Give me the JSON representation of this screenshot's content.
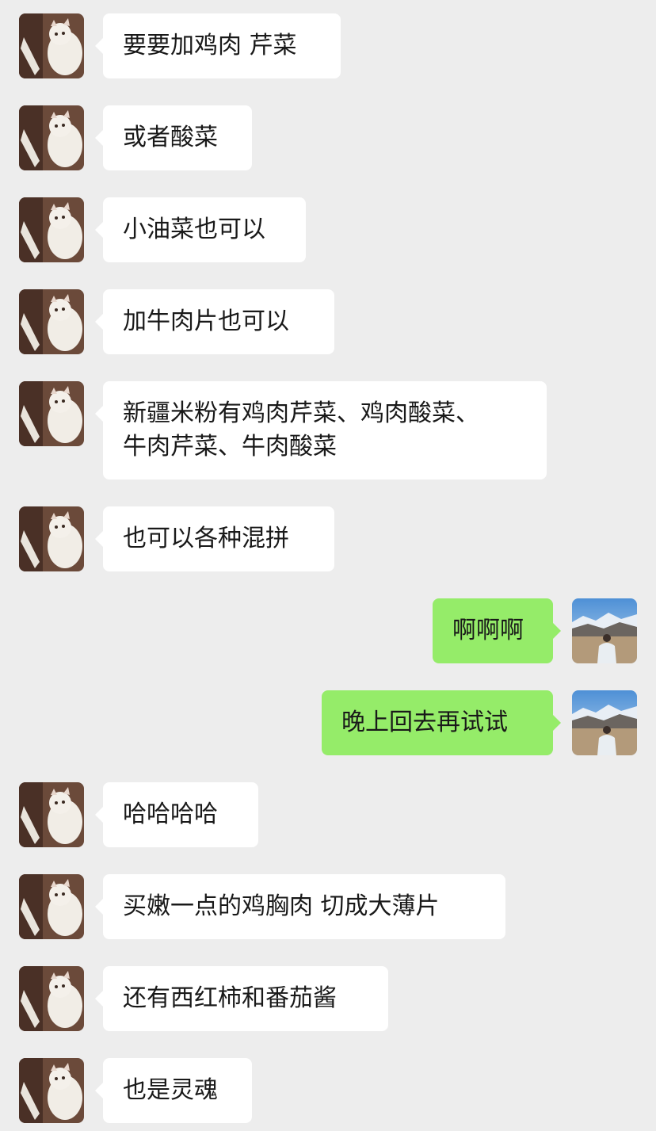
{
  "messages": [
    {
      "side": "left",
      "text": "要要加鸡肉 芹菜"
    },
    {
      "side": "left",
      "text": "或者酸菜"
    },
    {
      "side": "left",
      "text": "小油菜也可以"
    },
    {
      "side": "left",
      "text": "加牛肉片也可以"
    },
    {
      "side": "left",
      "text": "新疆米粉有鸡肉芹菜、鸡肉酸菜、\n牛肉芹菜、牛肉酸菜"
    },
    {
      "side": "left",
      "text": "也可以各种混拼"
    },
    {
      "side": "right",
      "text": "啊啊啊"
    },
    {
      "side": "right",
      "text": "晚上回去再试试"
    },
    {
      "side": "left",
      "text": "哈哈哈哈"
    },
    {
      "side": "left",
      "text": "买嫩一点的鸡胸肉 切成大薄片"
    },
    {
      "side": "left",
      "text": "还有西红柿和番茄酱"
    },
    {
      "side": "left",
      "text": "也是灵魂"
    }
  ],
  "colors": {
    "background": "#ededed",
    "incoming_bubble": "#ffffff",
    "outgoing_bubble": "#95ec69",
    "text": "#191919"
  },
  "icons": {
    "incoming_avatar": "cat-avatar-icon",
    "outgoing_avatar": "mountain-landscape-avatar-icon"
  }
}
